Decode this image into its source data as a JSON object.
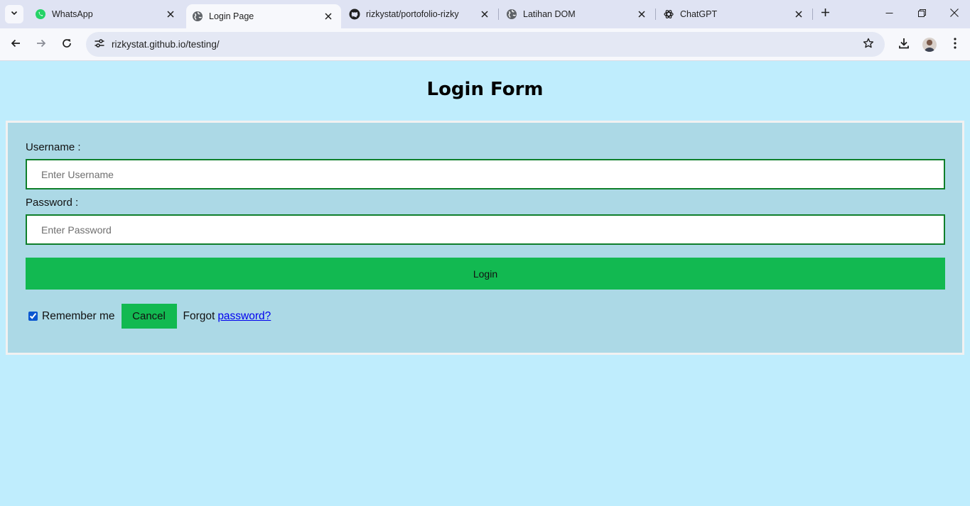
{
  "browser": {
    "tabs": [
      {
        "title": "WhatsApp",
        "favicon": "whatsapp-icon",
        "active": false
      },
      {
        "title": "Login Page",
        "favicon": "globe-icon",
        "active": true
      },
      {
        "title": "rizkystat/portofolio-rizky",
        "favicon": "github-icon",
        "active": false
      },
      {
        "title": "Latihan DOM",
        "favicon": "globe-icon",
        "active": false
      },
      {
        "title": "ChatGPT",
        "favicon": "chatgpt-icon",
        "active": false
      }
    ],
    "url": "rizkystat.github.io/testing/"
  },
  "page": {
    "title": "Login Form",
    "username_label": "Username :",
    "username_placeholder": "Enter Username",
    "password_label": "Password :",
    "password_placeholder": "Enter Password",
    "login_label": "Login",
    "remember_label": "Remember me",
    "remember_checked": true,
    "cancel_label": "Cancel",
    "forgot_text": "Forgot",
    "forgot_link": "password?"
  },
  "colors": {
    "page_background": "#bfedfd",
    "form_background": "#acd9e6",
    "button_green": "#12b951",
    "field_border": "#0f7f2b",
    "link": "#0000ee"
  }
}
